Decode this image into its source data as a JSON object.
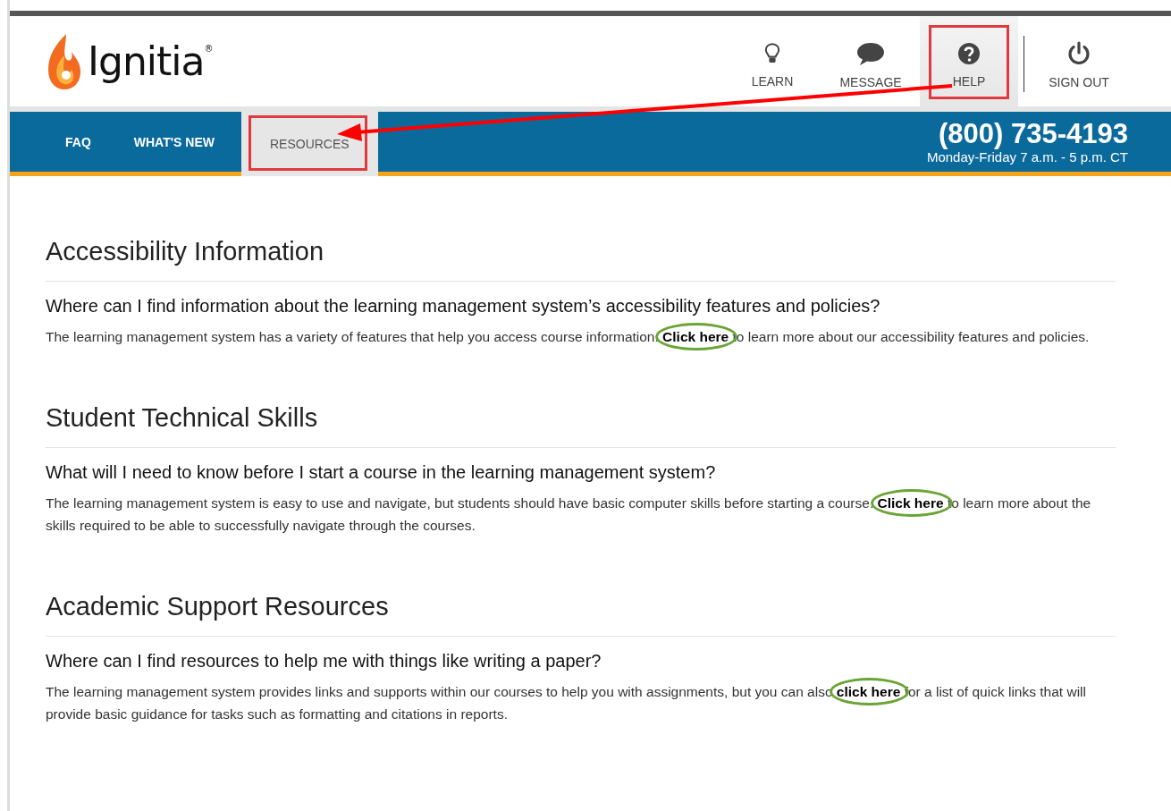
{
  "logo": {
    "text": "Ignitia",
    "mark": "®"
  },
  "nav": [
    {
      "label": "LEARN",
      "selected": false,
      "annotated": false
    },
    {
      "label": "MESSAGE",
      "selected": false,
      "annotated": false
    },
    {
      "label": "HELP",
      "selected": true,
      "annotated": true
    },
    {
      "label": "SIGN OUT",
      "selected": false,
      "annotated": false
    }
  ],
  "tabs": [
    {
      "label": "FAQ",
      "selected": false,
      "annotated": false
    },
    {
      "label": "WHAT'S NEW",
      "selected": false,
      "annotated": false
    },
    {
      "label": "RESOURCES",
      "selected": true,
      "annotated": true
    }
  ],
  "contact": {
    "phone": "(800) 735-4193",
    "hours": "Monday-Friday 7 a.m. - 5 p.m. CT"
  },
  "sections": [
    {
      "heading": "Accessibility Information",
      "question": "Where can I find information about the learning management system’s accessibility features and policies?",
      "before": "The learning management system has a variety of features that help you access course information.",
      "link": "Click here",
      "after": "to learn more about our accessibility features and policies.",
      "circled": true
    },
    {
      "heading": "Student Technical Skills",
      "question": "What will I need to know before I start a course in the learning management system?",
      "before": "The learning management system is easy to use and navigate, but students should have basic computer skills before starting a course.",
      "link": "Click here",
      "after": "to learn more about the skills required to be able to successfully navigate through the courses.",
      "circled": true
    },
    {
      "heading": "Academic Support Resources",
      "question": "Where can I find resources to help me with things like writing a paper?",
      "before": "The learning management system provides links and supports within our courses to help you with assignments, but you can also",
      "link": "click here",
      "after": "for a list of quick links that will provide basic guidance for tasks such as formatting and citations in reports.",
      "circled": true
    }
  ]
}
